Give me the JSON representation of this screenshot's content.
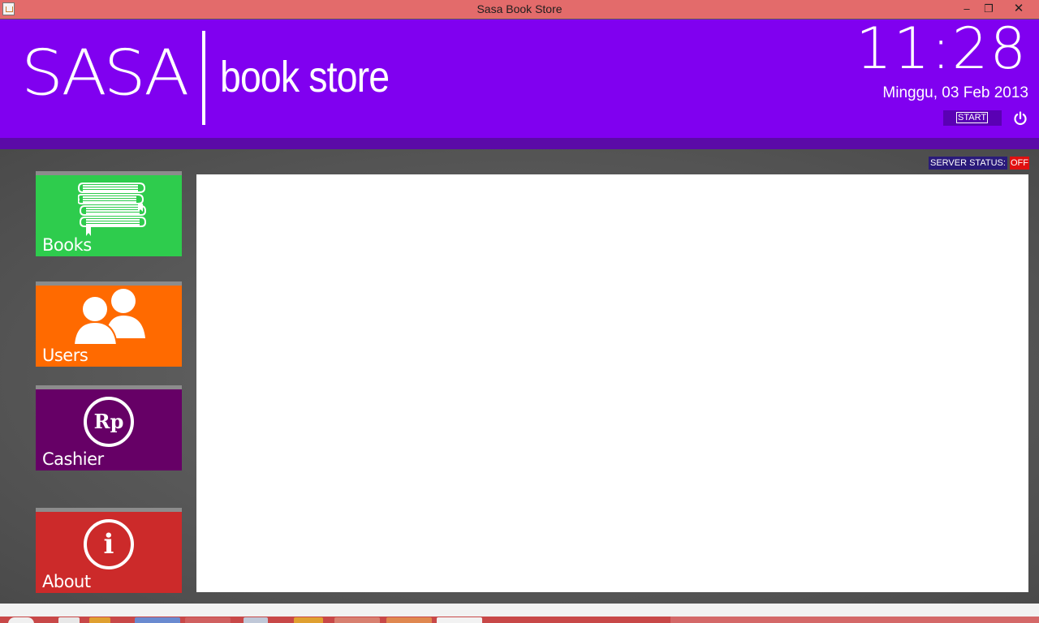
{
  "window": {
    "title": "Sasa Book Store",
    "controls": {
      "minimize": "‒",
      "maximize": "❐",
      "close": "✕"
    }
  },
  "header": {
    "logo": "SASA",
    "subtitle": "book store",
    "clock": "11:28",
    "date": "Minggu, 03 Feb 2013",
    "start_label": "START",
    "power_icon": "power-icon"
  },
  "server": {
    "label": "SERVER STATUS:",
    "value": "OFF",
    "value_color": "#e01010"
  },
  "tiles": [
    {
      "label": "Books",
      "icon": "books-icon",
      "color": "#2ecc4d"
    },
    {
      "label": "Users",
      "icon": "users-icon",
      "color": "#ff6a00"
    },
    {
      "label": "Cashier",
      "icon": "rupiah-icon",
      "icon_text": "Rp",
      "color": "#660066"
    },
    {
      "label": "About",
      "icon": "info-icon",
      "icon_text": "i",
      "color": "#cc2a2a"
    }
  ],
  "colors": {
    "header": "#8000f0",
    "header_band": "#5b0aa8",
    "title_bar": "#e36b6b"
  }
}
